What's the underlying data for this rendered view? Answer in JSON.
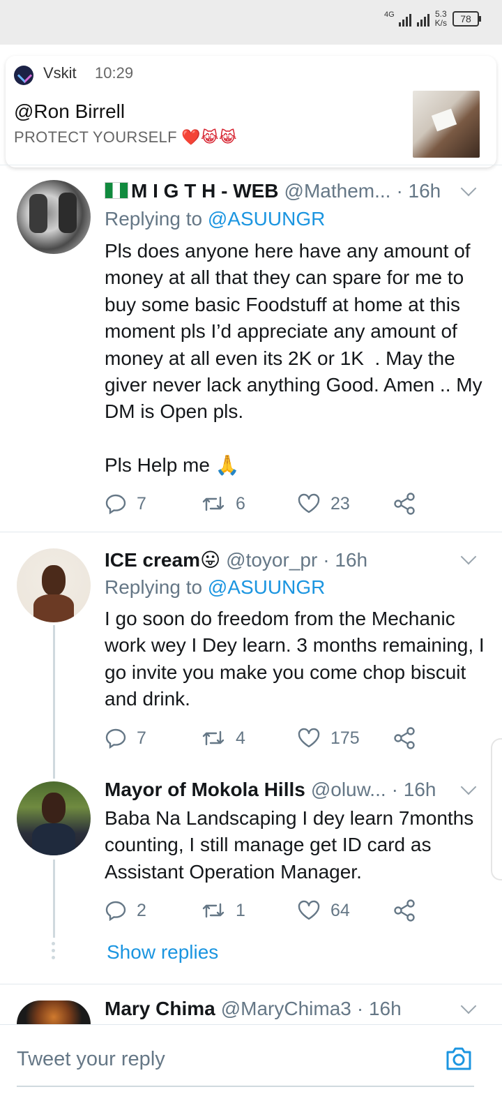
{
  "status_bar": {
    "network": "4G",
    "speed_value": "5.3",
    "speed_unit": "K/s",
    "battery": "78"
  },
  "notification": {
    "app": "Vskit",
    "time": "10:29",
    "title": "@Ron Birrell",
    "body": "PROTECT YOURSELF",
    "emoji": "❤️😹😹"
  },
  "tweets": [
    {
      "display_name": "M I G T H - WEB",
      "handle": "@Mathem...",
      "time": "· 16h",
      "replying_prefix": "Replying to",
      "replying_to": "@ASUUNGR",
      "text": "Pls does anyone here have any amount of money at all that they can spare for me to buy some basic Foodstuff at home at this moment pls I’d appreciate any amount of money at all even its 2K or 1K  . May the giver never lack anything Good. Amen .. My DM is Open pls.\n\nPls Help me 🙏",
      "replies": "7",
      "retweets": "6",
      "likes": "23"
    },
    {
      "display_name": "ICE cream😛",
      "handle": "@toyor_pr",
      "time": "· 16h",
      "replying_prefix": "Replying to",
      "replying_to": "@ASUUNGR",
      "text": "I go soon do freedom from the Mechanic work wey I Dey learn. 3 months remaining, I go invite you make you come chop biscuit and drink.",
      "replies": "7",
      "retweets": "4",
      "likes": "175"
    },
    {
      "display_name": "Mayor of Mokola Hills",
      "handle": "@oluw...",
      "time": "· 16h",
      "text": "Baba Na Landscaping I dey learn 7months counting, I still manage get ID card as Assistant Operation Manager.",
      "replies": "2",
      "retweets": "1",
      "likes": "64"
    },
    {
      "display_name": "Mary Chima",
      "handle": "@MaryChima3",
      "time": "· 16h"
    }
  ],
  "show_replies": "Show replies",
  "reply_placeholder": "Tweet your reply",
  "colors": {
    "link": "#1b95e0",
    "secondary_text": "#657786",
    "divider": "#e1e8ed"
  }
}
